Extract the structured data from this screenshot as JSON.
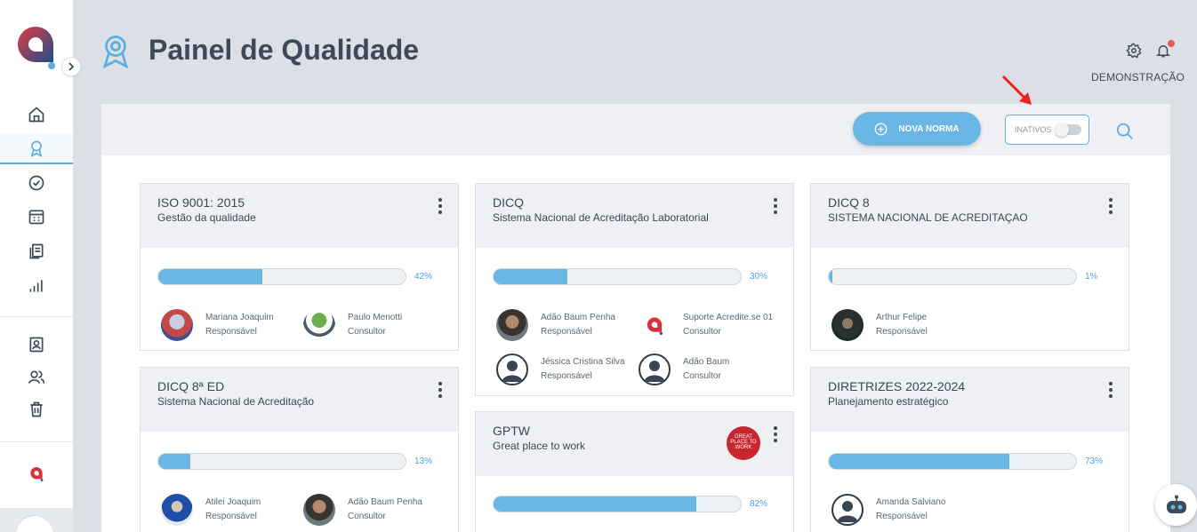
{
  "header": {
    "title": "Painel de Qualidade",
    "username": "DEMONSTRAÇÃO"
  },
  "toolbar": {
    "nova_label": "NOVA NORMA",
    "inativos_label": "INATIVOS",
    "inativos_on": false
  },
  "colors": {
    "accent": "#6ab6e4",
    "brand_red": "#e03a3e",
    "brand_blue": "#1f4e8c"
  },
  "sidebar": {
    "items": [
      {
        "icon": "home-icon"
      },
      {
        "icon": "award-icon",
        "active": true
      },
      {
        "icon": "check-circle-icon"
      },
      {
        "icon": "calendar-icon"
      },
      {
        "icon": "documents-icon"
      },
      {
        "icon": "bar-chart-icon"
      },
      {
        "icon": "contact-card-icon"
      },
      {
        "icon": "users-icon"
      },
      {
        "icon": "trash-icon"
      }
    ]
  },
  "cards": [
    {
      "title": "ISO 9001: 2015",
      "subtitle": "Gestão da qualidade",
      "progress": 42,
      "progress_label": "42%",
      "members": [
        {
          "name": "Mariana Joaquim",
          "role": "Responsável"
        },
        {
          "name": "Paulo Menotti",
          "role": "Consultor"
        }
      ]
    },
    {
      "title": "DICQ",
      "subtitle": "Sistema Nacional de Acreditação Laboratorial",
      "progress": 30,
      "progress_label": "30%",
      "members": [
        {
          "name": "Adão Baum Penha",
          "role": "Responsável"
        },
        {
          "name": "Suporte Acredite.se 01",
          "role": "Consultor"
        },
        {
          "name": "Jéssica Cristina Silva",
          "role": "Responsável"
        },
        {
          "name": "Adão Baum",
          "role": "Consultor"
        }
      ]
    },
    {
      "title": "DICQ 8",
      "subtitle": "SISTEMA NACIONAL DE ACREDITAÇAO",
      "progress": 1,
      "progress_label": "1%",
      "members": [
        {
          "name": "Arthur Felipe",
          "role": "Responsável"
        }
      ]
    },
    {
      "title": "DICQ 8ª ED",
      "subtitle": "Sistema Nacional de Acreditação",
      "progress": 13,
      "progress_label": "13%",
      "members": [
        {
          "name": "Atilei Joaquim",
          "role": "Responsável"
        },
        {
          "name": "Adão Baum Penha",
          "role": "Consultor"
        }
      ]
    },
    {
      "title": "GPTW",
      "subtitle": "Great place to work",
      "logo_text": "GREAT PLACE TO WORK",
      "progress": 82,
      "progress_label": "82%",
      "members": []
    },
    {
      "title": "DIRETRIZES 2022-2024",
      "subtitle": "Planejamento estratégico",
      "progress": 73,
      "progress_label": "73%",
      "members": [
        {
          "name": "Amanda Salviano",
          "role": "Responsável"
        }
      ]
    }
  ]
}
